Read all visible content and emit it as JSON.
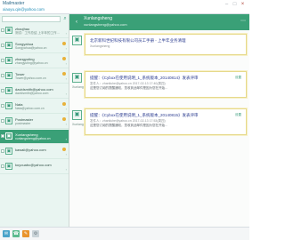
{
  "window": {
    "title": "Mailmaster",
    "user": "xiaoyu.qin@yahoo.com",
    "min": "–",
    "max": "□",
    "close": "×"
  },
  "sidebar": {
    "search_icon": "magnifier-icon",
    "items": [
      {
        "name": "zhaojhao",
        "sub": "测试：工作总结 上半年的工作…",
        "active": false,
        "icon": "▣"
      },
      {
        "name": "Songyahua",
        "sub": "Songyahua@yahoo.cn",
        "active": false,
        "icon": "▣"
      },
      {
        "name": "zhangyuting",
        "sub": "zhangyuting@yahoo.cn",
        "active": false,
        "icon": "▣"
      },
      {
        "name": "Tower",
        "sub": "Tower@yahoo.com.cn",
        "active": false,
        "icon": "▣"
      },
      {
        "name": "davidsmith@yahoo.com",
        "sub": "davidsmith@yahoo.com",
        "active": false,
        "icon": "▣"
      },
      {
        "name": "Nata",
        "sub": "Nata@yahoo.com.cn",
        "active": false,
        "icon": "▣"
      },
      {
        "name": "Postmaster",
        "sub": "postmaster",
        "active": false,
        "icon": "▣"
      },
      {
        "name": "Xunlangsheng",
        "sub": "xunlangsheng@yahoo.cn",
        "active": true,
        "icon": "▣"
      },
      {
        "name": "kawaii@yahoo.com",
        "sub": "",
        "active": false,
        "icon": "▣"
      },
      {
        "name": "kuyouabc@yahoo.com",
        "sub": "",
        "active": false,
        "icon": "▣"
      }
    ]
  },
  "header": {
    "back_icon": "‹",
    "name": "Xunlangsheng",
    "email": "xunlangsheng@yahoo.com",
    "more_icon": "⋯"
  },
  "messages": [
    {
      "subject": "北京新科世纪科技有限公司员工手册 - 上半年业务清理",
      "meta": "Xunlangsheng",
      "body": "",
      "link": "",
      "name": "Xunlangsheng",
      "time": ""
    },
    {
      "subject": "提醒：《Cybox在使用说明_1_系统版本_20140814》发表评审",
      "meta": "发件人：zhanliuhe@yahoo.cn  2017-02-13 17:40(周四)",
      "body": "这是您订阅的提醒通知，您收到此邮件是因为您在开始…",
      "link": "设置",
      "name": "Xunlangsheng",
      "time": ""
    },
    {
      "subject": "提醒：《Cybox在使用说明_1_系统版本_20140815》发表评审",
      "meta": "发件人：zhanliuhe@yahoo.cn  2017-02-13 17:53(周四)",
      "body": "这是您订阅的提醒通知，您收到此邮件是因为您在开始…",
      "link": "设置",
      "name": "Xunlangsheng",
      "time": ""
    }
  ],
  "bottombar": {
    "buttons": [
      "✉",
      "☎",
      "✎",
      "⚙"
    ]
  }
}
